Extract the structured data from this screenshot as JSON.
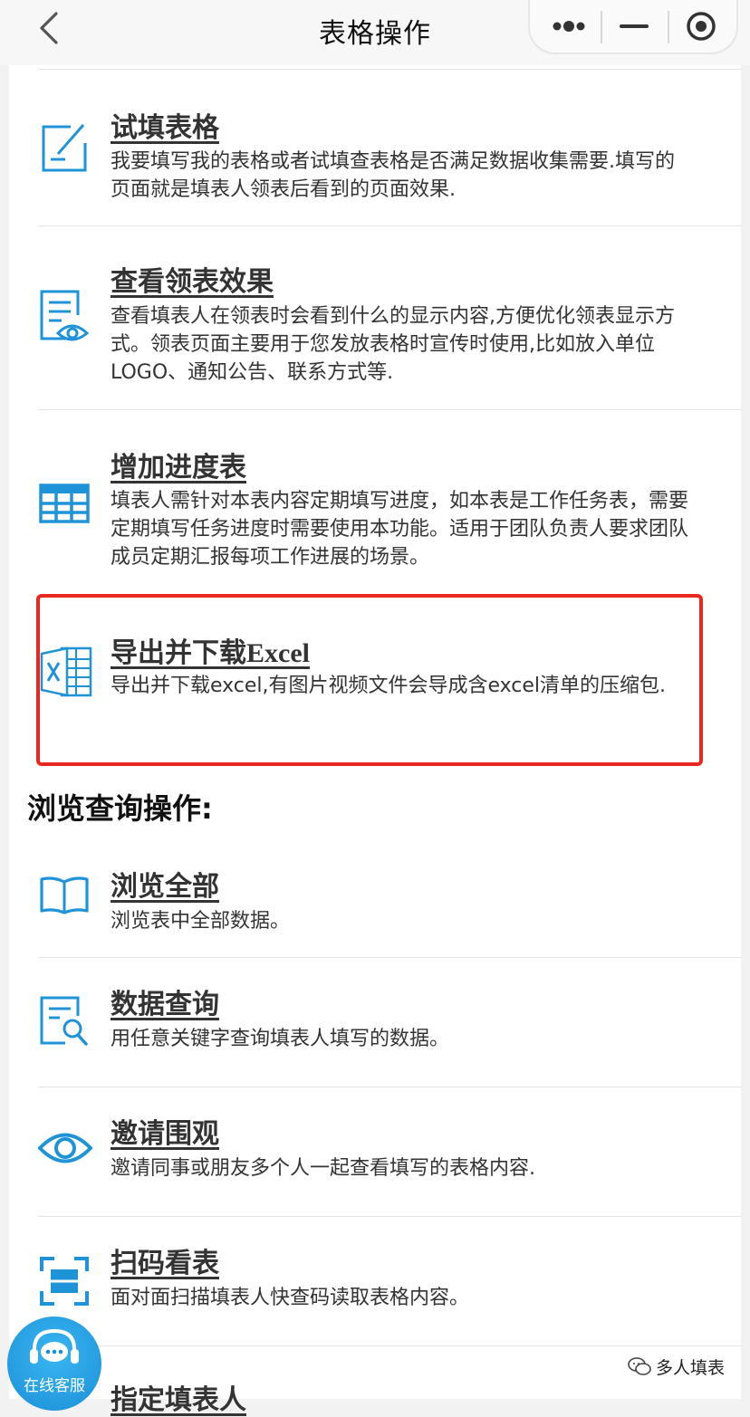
{
  "header": {
    "title": "表格操作"
  },
  "items": [
    {
      "title": "试填表格",
      "desc": "我要填写我的表格或者试填查表格是否满足数据收集需要.填写的页面就是填表人领表后看到的页面效果."
    },
    {
      "title": "查看领表效果",
      "desc": "查看填表人在领表时会看到什么的显示内容,方便优化领表显示方式。领表页面主要用于您发放表格时宣传时使用,比如放入单位LOGO、通知公告、联系方式等."
    },
    {
      "title": "增加进度表",
      "desc": "填表人需针对本表内容定期填写进度，如本表是工作任务表，需要定期填写任务进度时需要使用本功能。适用于团队负责人要求团队成员定期汇报每项工作进展的场景。"
    },
    {
      "title": "导出并下载Excel",
      "desc": "导出并下载excel,有图片视频文件会导成含excel清单的压缩包."
    }
  ],
  "browse_section": {
    "title": "浏览查询操作:",
    "items": [
      {
        "title": "浏览全部",
        "desc": "浏览表中全部数据。"
      },
      {
        "title": "数据查询",
        "desc": "用任意关键字查询填表人填写的数据。"
      },
      {
        "title": "邀请围观",
        "desc": "邀请同事或朋友多个人一起查看填写的表格内容."
      },
      {
        "title": "扫码看表",
        "desc": "面对面扫描填表人快查码读取表格内容。"
      },
      {
        "title": "指定填表人",
        "desc": ""
      }
    ]
  },
  "customer_service": {
    "label": "在线客服"
  },
  "watermark": {
    "text": "多人填表"
  },
  "colors": {
    "accent": "#1b8fd6",
    "highlight": "#e8281e"
  }
}
